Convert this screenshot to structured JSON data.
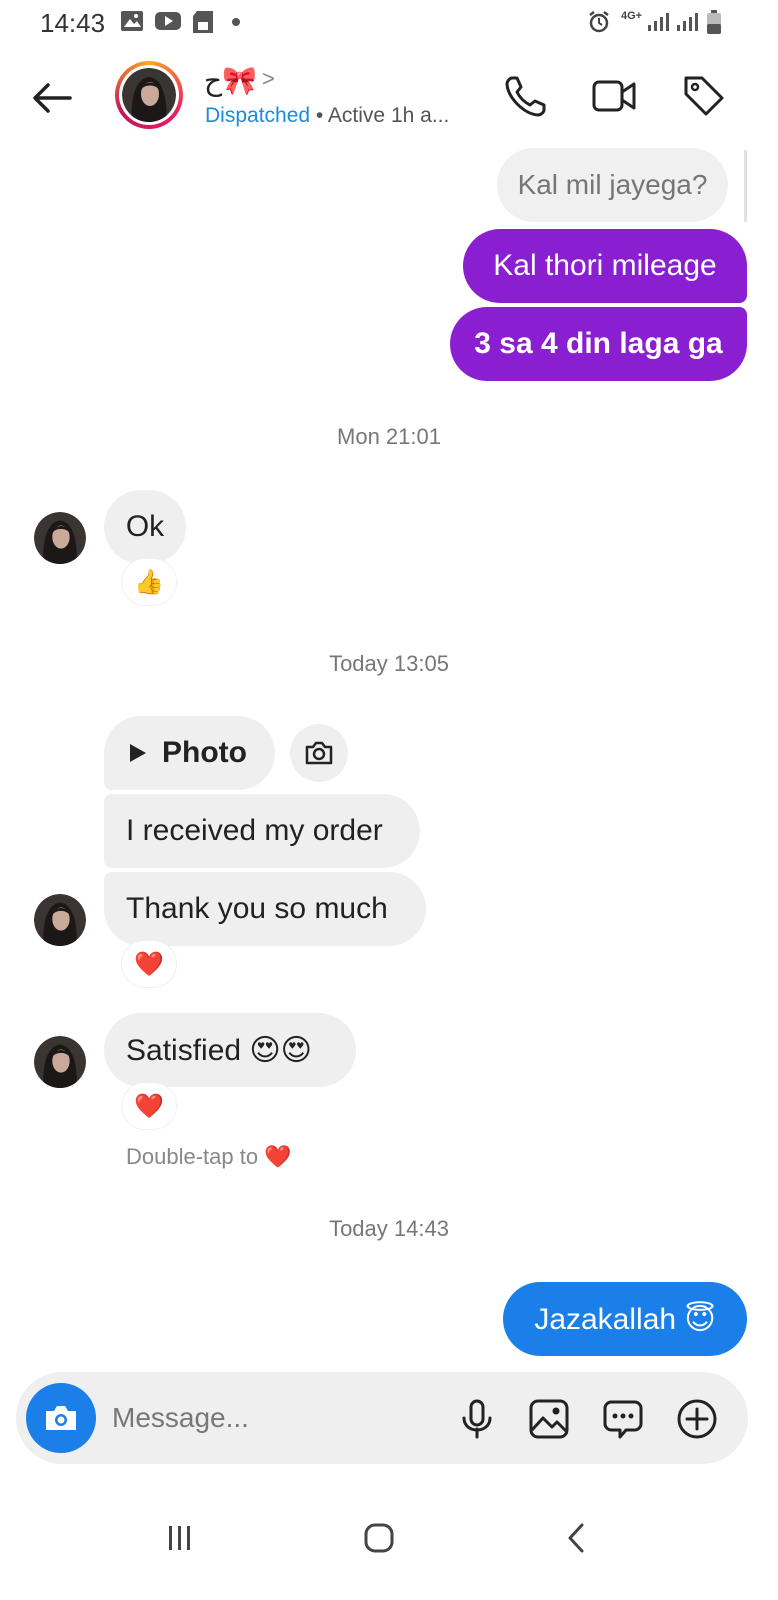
{
  "status_bar": {
    "time": "14:43",
    "network": "4G+"
  },
  "header": {
    "name": "ح🎀",
    "chevron": ">",
    "status_highlight": "Dispatched",
    "status_rest": " • Active 1h a..."
  },
  "messages": {
    "out_1": "Kal mil jayega?",
    "out_2": "Kal thori mileage",
    "out_3": "3 sa 4 din laga ga",
    "ts_1": "Mon 21:01",
    "in_ok": "Ok",
    "in_ok_reaction": "👍",
    "ts_2": "Today 13:05",
    "photo_label": "Photo",
    "in_received": "I received my order",
    "in_thanks": "Thank you so much",
    "in_thanks_reaction": "❤️",
    "in_satisfied": "Satisfied 😍😍",
    "in_satisfied_reaction": "❤️",
    "hint": "Double-tap to ❤️",
    "ts_3": "Today 14:43",
    "out_4": "Jazakallah 😇"
  },
  "composer": {
    "placeholder": "Message..."
  },
  "colors": {
    "purple_bubble": "#8a1fd1",
    "blue_bubble": "#1a7fe8",
    "link_blue": "#1a8cdc",
    "incoming_bubble": "#efefef"
  },
  "icons": {
    "back": "arrow-left-icon",
    "call": "phone-icon",
    "video": "video-camera-icon",
    "tag": "tag-icon",
    "camera": "camera-icon",
    "mic": "microphone-icon",
    "gallery": "image-icon",
    "sticker": "chat-bubble-icon",
    "more": "plus-circle-icon"
  }
}
